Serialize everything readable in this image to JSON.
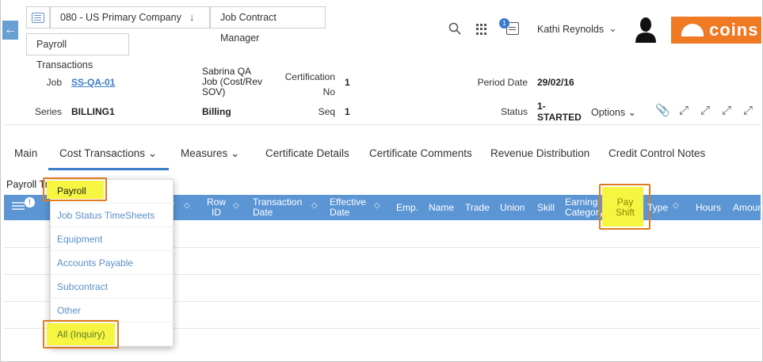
{
  "breadcrumbs": {
    "company": "080 - US Primary Company",
    "module": "Job Contract Manager",
    "page": "Payroll Transactions"
  },
  "header": {
    "notification_count": "1",
    "user_name": "Kathi Reynolds",
    "logo_text": "coins",
    "brand_color": "#f07a23"
  },
  "info": {
    "job_label": "Job",
    "job_value": "SS-QA-01",
    "job_desc_lines": [
      "Sabrina QA",
      "Job (Cost/Rev",
      "SOV)"
    ],
    "certification_label_lines": [
      "Certification",
      "No"
    ],
    "certification_value": "1",
    "period_date_label": "Period Date",
    "period_date_value": "29/02/16",
    "series_label": "Series",
    "series_value": "BILLING1",
    "series_desc": "Billing",
    "seq_label": "Seq",
    "seq_value": "1",
    "status_label": "Status",
    "status_value_lines": [
      "1-",
      "STARTED"
    ],
    "options_label": "Options"
  },
  "tabs": [
    "Main",
    "Cost Transactions",
    "Measures",
    "Certificate Details",
    "Certificate Comments",
    "Revenue Distribution",
    "Credit Control Notes"
  ],
  "grid": {
    "title": "Payroll Tra",
    "column_badge": "!",
    "columns": {
      "row_id": [
        "Row",
        "ID"
      ],
      "transaction_date": [
        "Transaction",
        "Date"
      ],
      "effective_date": [
        "Effective",
        "Date"
      ],
      "emp": "Emp.",
      "name": "Name",
      "trade": "Trade",
      "union": "Union",
      "skill": "Skill",
      "earning_category": [
        "Earning",
        "Category"
      ],
      "pay_shift": [
        "Pay",
        "Shift"
      ],
      "type": "Type",
      "hours": "Hours",
      "amount": "Amoun"
    },
    "header_color": "#5b95d4"
  },
  "menu": {
    "items": [
      "Payroll",
      "Job Status TimeSheets",
      "Equipment",
      "Accounts Payable",
      "Subcontract",
      "Other",
      "All (Inquiry)"
    ]
  },
  "annotations": {
    "highlight_color": "#f5f542",
    "box_color": "#e07a1f"
  }
}
